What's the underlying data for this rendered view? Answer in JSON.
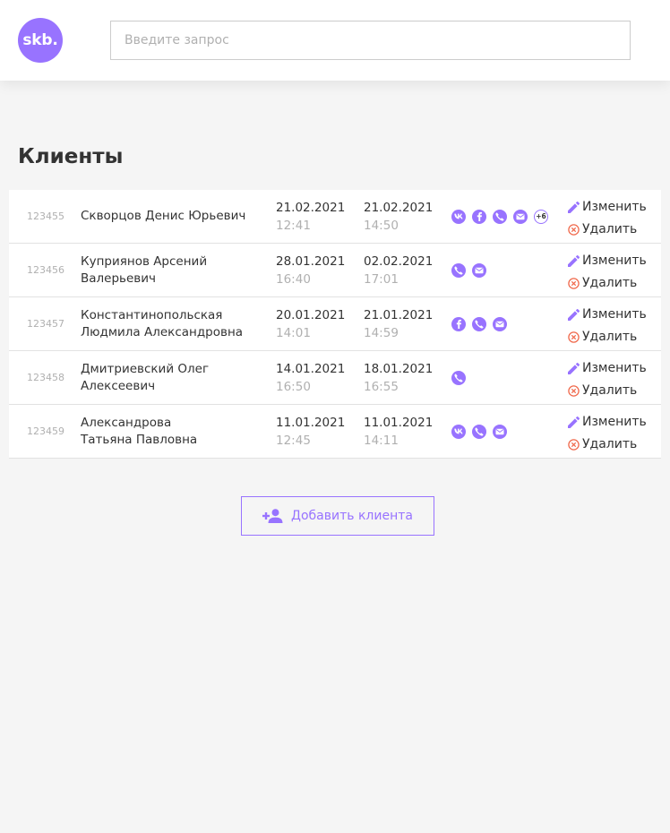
{
  "header": {
    "logo_text": "skb.",
    "search_placeholder": "Введите запрос"
  },
  "page": {
    "title": "Клиенты"
  },
  "colors": {
    "accent": "#9873ff",
    "danger": "#f06a4d",
    "muted": "#b0b0b0",
    "text": "#333333"
  },
  "actions": {
    "edit_label": "Изменить",
    "delete_label": "Удалить"
  },
  "clients": [
    {
      "id": "123455",
      "name_line1": "Скворцов Денис Юрьевич",
      "name_line2": "",
      "created_date": "21.02.2021",
      "created_time": "12:41",
      "changed_date": "21.02.2021",
      "changed_time": "14:50",
      "contacts": [
        "vk-icon",
        "facebook-icon",
        "phone-icon",
        "mail-icon"
      ],
      "more_contacts": "+6"
    },
    {
      "id": "123456",
      "name_line1": "Куприянов Арсений",
      "name_line2": "Валерьевич",
      "created_date": "28.01.2021",
      "created_time": "16:40",
      "changed_date": "02.02.2021",
      "changed_time": "17:01",
      "contacts": [
        "phone-icon",
        "mail-icon"
      ],
      "more_contacts": ""
    },
    {
      "id": "123457",
      "name_line1": "Константинопольская",
      "name_line2": "Людмила Александровна",
      "created_date": "20.01.2021",
      "created_time": "14:01",
      "changed_date": "21.01.2021",
      "changed_time": "14:59",
      "contacts": [
        "facebook-icon",
        "phone-icon",
        "mail-icon"
      ],
      "more_contacts": ""
    },
    {
      "id": "123458",
      "name_line1": "Дмитриевский Олег",
      "name_line2": "Алексеевич",
      "created_date": "14.01.2021",
      "created_time": "16:50",
      "changed_date": "18.01.2021",
      "changed_time": "16:55",
      "contacts": [
        "phone-icon"
      ],
      "more_contacts": ""
    },
    {
      "id": "123459",
      "name_line1": "Александрова",
      "name_line2": "Татьяна Павловна",
      "created_date": "11.01.2021",
      "created_time": "12:45",
      "changed_date": "11.01.2021",
      "changed_time": "14:11",
      "contacts": [
        "vk-icon",
        "phone-icon",
        "mail-icon"
      ],
      "more_contacts": ""
    }
  ],
  "add_button": {
    "label": "Добавить клиента"
  }
}
